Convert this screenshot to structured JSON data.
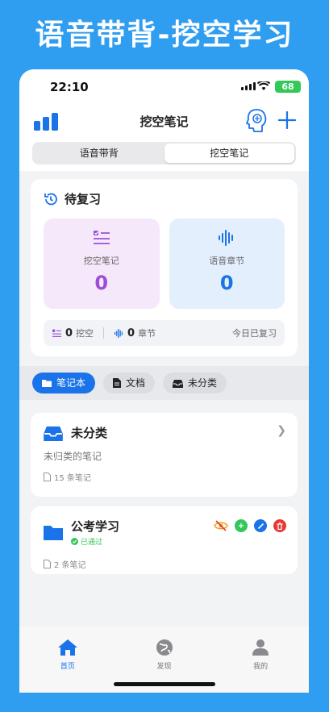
{
  "banner": {
    "title": "语音带背-挖空学习"
  },
  "status": {
    "time": "22:10",
    "battery": "68"
  },
  "nav": {
    "title": "挖空笔记"
  },
  "segments": [
    "语音带背",
    "挖空笔记"
  ],
  "review": {
    "title": "待复习",
    "boxes": [
      {
        "label": "挖空笔记",
        "value": "0",
        "color": "#9c4fd6"
      },
      {
        "label": "语音章节",
        "value": "0",
        "color": "#1a73e8"
      }
    ],
    "stats": {
      "cloze_count": "0",
      "cloze_label": "挖空",
      "chapter_count": "0",
      "chapter_label": "章节",
      "today": "今日已复习"
    }
  },
  "tabs": [
    "笔记本",
    "文档",
    "未分类"
  ],
  "notebooks": [
    {
      "title": "未分类",
      "subtitle": "未归类的笔记",
      "count": "15 条笔记"
    },
    {
      "title": "公考学习",
      "status": "已通过",
      "count": "2 条笔记"
    }
  ],
  "tabbar": [
    "首页",
    "发现",
    "我的"
  ],
  "colors": {
    "accent": "#1a73e8",
    "purple": "#9c4fd6",
    "green": "#34c759",
    "red": "#e53935"
  }
}
